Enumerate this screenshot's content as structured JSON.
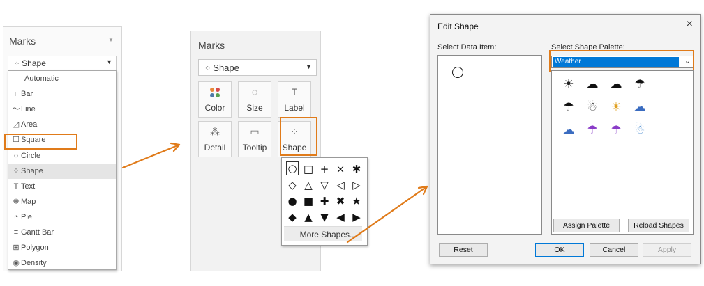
{
  "panel1": {
    "title": "Marks",
    "combo_label": "Shape",
    "items": [
      {
        "icon": "",
        "label": "Automatic"
      },
      {
        "icon": "ıl",
        "label": "Bar"
      },
      {
        "icon": "〜",
        "label": "Line"
      },
      {
        "icon": "◿",
        "label": "Area"
      },
      {
        "icon": "☐",
        "label": "Square"
      },
      {
        "icon": "○",
        "label": "Circle"
      },
      {
        "icon": "⁘",
        "label": "Shape"
      },
      {
        "icon": "T",
        "label": "Text"
      },
      {
        "icon": "⛯",
        "label": "Map"
      },
      {
        "icon": "◔",
        "label": "Pie"
      },
      {
        "icon": "≡",
        "label": "Gantt Bar"
      },
      {
        "icon": "⊞",
        "label": "Polygon"
      },
      {
        "icon": "◉",
        "label": "Density"
      }
    ]
  },
  "panel2": {
    "title": "Marks",
    "combo_label": "Shape",
    "buttons": [
      {
        "icon": "⁘",
        "label": "Color"
      },
      {
        "icon": "◌",
        "label": "Size"
      },
      {
        "icon": "T",
        "label": "Label"
      },
      {
        "icon": "⁂",
        "label": "Detail"
      },
      {
        "icon": "▭",
        "label": "Tooltip"
      },
      {
        "icon": "⁘",
        "label": "Shape"
      }
    ],
    "shapes": [
      [
        "○",
        "□",
        "+",
        "×",
        "✱"
      ],
      [
        "◇",
        "△",
        "▽",
        "◁",
        "▷"
      ],
      [
        "●",
        "■",
        "✚",
        "✖",
        "★"
      ],
      [
        "◆",
        "▲",
        "▼",
        "◀",
        "▶"
      ]
    ],
    "more_shapes": "More Shapes..."
  },
  "dialog": {
    "title": "Edit Shape",
    "close_icon": "×",
    "select_data_item": "Select Data Item:",
    "select_palette": "Select Shape Palette:",
    "palette_value": "Weather",
    "weather_icons": [
      [
        {
          "g": "☀",
          "c": "#222"
        },
        {
          "g": "☁",
          "c": "#111"
        },
        {
          "g": "☁",
          "c": "#111"
        },
        {
          "g": "☂",
          "c": "#111"
        }
      ],
      [
        {
          "g": "☂",
          "c": "#111"
        },
        {
          "g": "☃",
          "c": "#555"
        },
        {
          "g": "☀",
          "c": "#e0a020"
        },
        {
          "g": "☁",
          "c": "#3a6cc0"
        }
      ],
      [
        {
          "g": "☁",
          "c": "#3a6cc0"
        },
        {
          "g": "☂",
          "c": "#8a3cc8"
        },
        {
          "g": "☂",
          "c": "#8a3cc8"
        },
        {
          "g": "☃",
          "c": "#6aa0d8"
        }
      ]
    ],
    "assign_palette": "Assign Palette",
    "reload_shapes": "Reload Shapes",
    "reset": "Reset",
    "ok": "OK",
    "cancel": "Cancel",
    "apply": "Apply"
  },
  "colors": {
    "highlight": "#e07b1a",
    "selection": "#0078d7"
  }
}
